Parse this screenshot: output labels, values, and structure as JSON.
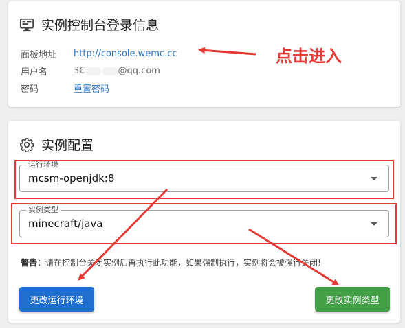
{
  "login_card": {
    "title": "实例控制台登录信息",
    "rows": [
      {
        "label": "面板地址",
        "value": "http://console.wemc.cc"
      },
      {
        "label": "用户名",
        "value_prefix": "3€",
        "value_suffix": "@qq.com"
      },
      {
        "label": "密码",
        "value": "重置密码"
      }
    ]
  },
  "config_card": {
    "title": "实例配置",
    "env_field": {
      "legend": "运行环境",
      "value": "mcsm-openjdk:8"
    },
    "type_field": {
      "legend": "实例类型",
      "value": "minecraft/java"
    },
    "warning_bold": "警告：",
    "warning_text": "请在控制台关闭实例后再执行此功能，如果强制执行，实例将会被强行关闭!",
    "btn_change_env": "更改运行环境",
    "btn_change_type": "更改实例类型"
  },
  "annotation": {
    "text": "点击进入",
    "color": "#e53935"
  },
  "colors": {
    "link": "#2a72c2",
    "primary": "#1e6fcf",
    "success": "#43a047",
    "highlight": "#e53935"
  },
  "icons": {
    "login_card": "monitor-icon",
    "config_card": "gear-icon",
    "select_caret": "caret-down-icon"
  }
}
